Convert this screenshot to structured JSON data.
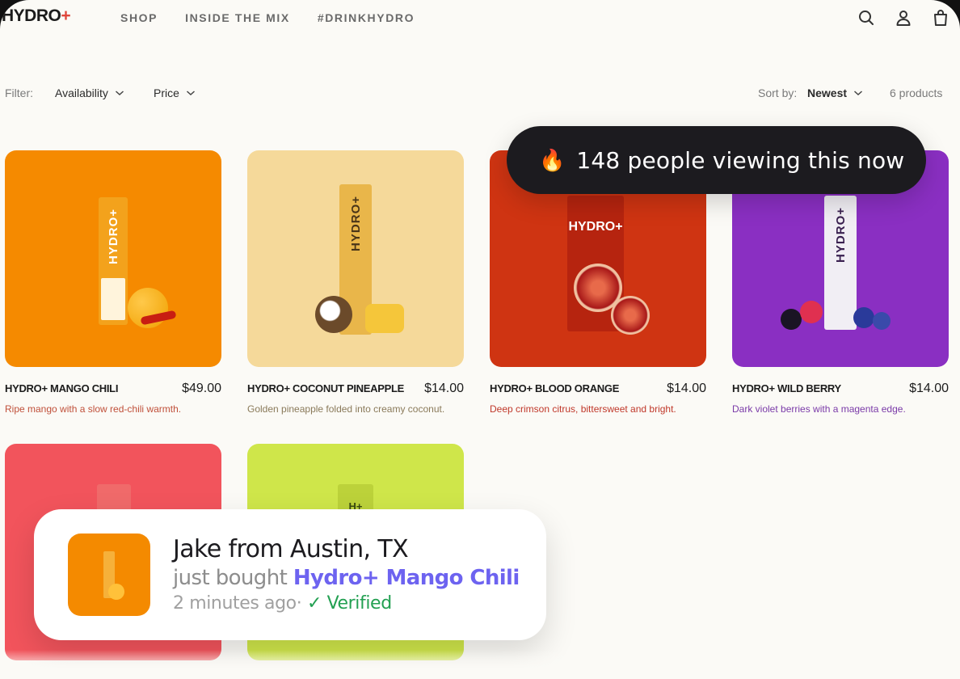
{
  "brand": {
    "name": "HYDRO",
    "plus": "+"
  },
  "nav": [
    "SHOP",
    "INSIDE THE MIX",
    "#DRINKHYDRO"
  ],
  "header_icons": [
    "search-icon",
    "account-icon",
    "bag-icon"
  ],
  "filters": {
    "label": "Filter:",
    "availability": "Availability",
    "price": "Price",
    "sort_label": "Sort by:",
    "sort_value": "Newest",
    "count": "6 products"
  },
  "products": [
    {
      "name": "HYDRO+ MANGO CHILI",
      "price": "$49.00",
      "desc": "Ripe mango with a slow red-chili warmth.",
      "bg": "#f58a00",
      "desc_color": "#c0503a",
      "packet_color": "#f3a21c",
      "packet_label": "HYDRO+"
    },
    {
      "name": "HYDRO+ COCONUT PINEAPPLE",
      "price": "$14.00",
      "desc": "Golden pineapple folded into creamy coconut.",
      "bg": "#f5d99a",
      "desc_color": "#8a7a5a",
      "packet_color": "#e9b64a",
      "packet_label": "HYDRO+"
    },
    {
      "name": "HYDRO+ BLOOD ORANGE",
      "price": "$14.00",
      "desc": "Deep crimson citrus, bittersweet and bright.",
      "bg": "#cf3412",
      "desc_color": "#c0382a",
      "packet_color": "#b6240f",
      "packet_label": "HYDRO+"
    },
    {
      "name": "HYDRO+ WILD BERRY",
      "price": "$14.00",
      "desc": "Dark violet berries with a magenta edge.",
      "bg": "#8a2fc2",
      "desc_color": "#7a3aa8",
      "packet_color": "#f1eef4",
      "packet_label": "HYDRO+"
    },
    {
      "name": "",
      "price": "",
      "desc": "",
      "bg": "#f2545c",
      "desc_color": "#c04a4a",
      "packet_color": "#f06a6a",
      "packet_label": ""
    },
    {
      "name": "",
      "price": "",
      "desc": "",
      "bg": "#cfe64a",
      "desc_color": "#7a8a2a",
      "packet_color": "#bcd23a",
      "packet_label": "H+"
    }
  ],
  "viewing": {
    "icon": "fire-icon",
    "emoji": "🔥",
    "text": "148 people viewing this now"
  },
  "toast": {
    "who": "Jake from Austin, TX",
    "action": "just bought",
    "product": "Hydro+ Mango Chili",
    "time": "2 minutes ago",
    "separator": "·",
    "verified": "✓ Verified",
    "verified_color": "#23a052",
    "product_color": "#6d63f0"
  }
}
